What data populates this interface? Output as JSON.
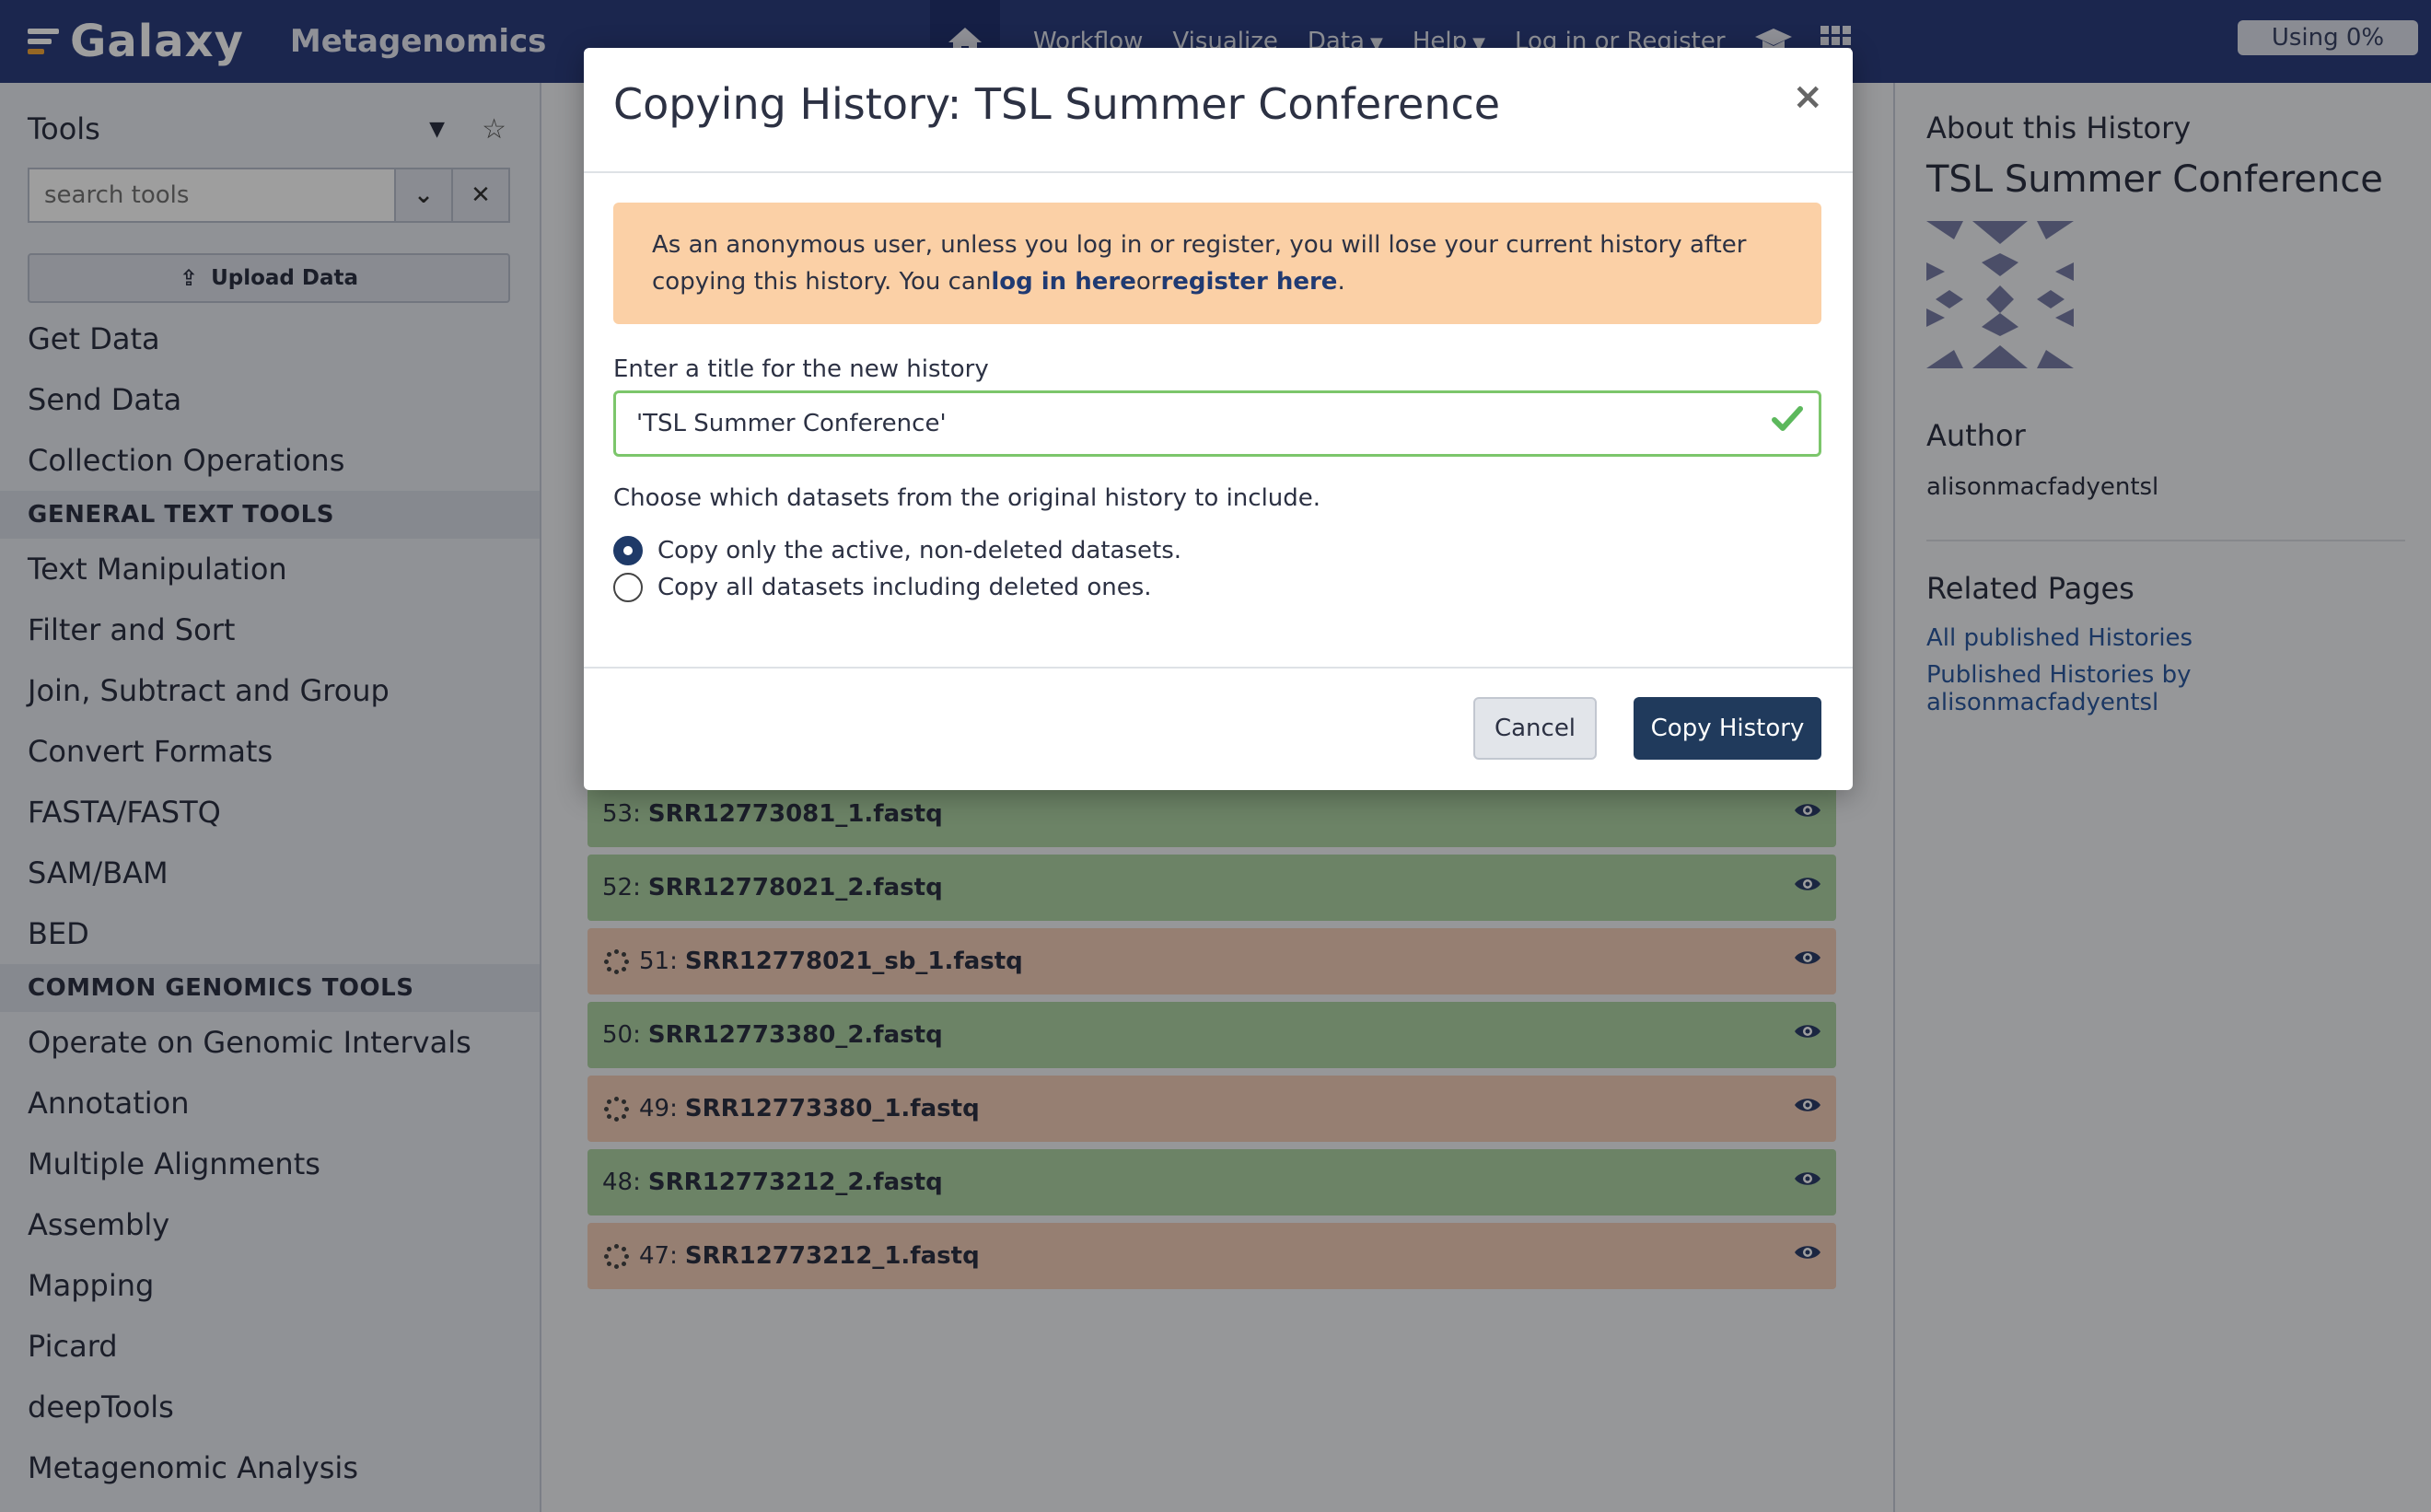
{
  "masthead": {
    "brand": "Galaxy",
    "subtitle": "Metagenomics",
    "nav": {
      "workflow": "Workflow",
      "visualize": "Visualize",
      "data": "Data",
      "help": "Help",
      "login": "Log in or Register"
    },
    "quota": "Using 0%"
  },
  "tools": {
    "title": "Tools",
    "search_placeholder": "search tools",
    "upload_label": "Upload Data",
    "items": [
      {
        "type": "item",
        "label": "Get Data"
      },
      {
        "type": "item",
        "label": "Send Data"
      },
      {
        "type": "item",
        "label": "Collection Operations"
      },
      {
        "type": "section",
        "label": "GENERAL TEXT TOOLS"
      },
      {
        "type": "item",
        "label": "Text Manipulation"
      },
      {
        "type": "item",
        "label": "Filter and Sort"
      },
      {
        "type": "item",
        "label": "Join, Subtract and Group"
      },
      {
        "type": "item",
        "label": "Convert Formats"
      },
      {
        "type": "item",
        "label": "FASTA/FASTQ"
      },
      {
        "type": "item",
        "label": "SAM/BAM"
      },
      {
        "type": "item",
        "label": "BED"
      },
      {
        "type": "section",
        "label": "COMMON GENOMICS TOOLS"
      },
      {
        "type": "item",
        "label": "Operate on Genomic Intervals"
      },
      {
        "type": "item",
        "label": "Annotation"
      },
      {
        "type": "item",
        "label": "Multiple Alignments"
      },
      {
        "type": "item",
        "label": "Assembly"
      },
      {
        "type": "item",
        "label": "Mapping"
      },
      {
        "type": "item",
        "label": "Picard"
      },
      {
        "type": "item",
        "label": "deepTools"
      },
      {
        "type": "item",
        "label": "Metagenomic Analysis"
      }
    ]
  },
  "datasets": [
    {
      "hid": "53:",
      "name": "SRR12773081_1.fastq",
      "state": "ok"
    },
    {
      "hid": "52:",
      "name": "SRR12778021_2.fastq",
      "state": "ok"
    },
    {
      "hid": "51:",
      "name": "SRR12778021_sb_1.fastq",
      "state": "queued"
    },
    {
      "hid": "50:",
      "name": "SRR12773380_2.fastq",
      "state": "ok"
    },
    {
      "hid": "49:",
      "name": "SRR12773380_1.fastq",
      "state": "queued"
    },
    {
      "hid": "48:",
      "name": "SRR12773212_2.fastq",
      "state": "ok"
    },
    {
      "hid": "47:",
      "name": "SRR12773212_1.fastq",
      "state": "queued"
    }
  ],
  "about": {
    "heading": "About this History",
    "title": "TSL Summer Conference",
    "author_heading": "Author",
    "author": "alisonmacfadyentsl",
    "related_heading": "Related Pages",
    "link_all": "All published Histories",
    "link_by_author": "Published Histories by alisonmacfadyentsl"
  },
  "modal": {
    "title": "Copying History: TSL Summer Conference",
    "close": "×",
    "alert_text": "As an anonymous user, unless you log in or register, you will lose your current history after copying this history. You can",
    "alert_login": "log in here",
    "alert_or": "or",
    "alert_register": "register here",
    "alert_end": ".",
    "title_label": "Enter a title for the new history",
    "title_value": "'TSL Summer Conference'",
    "choose_label": "Choose which datasets from the original history to include.",
    "option_active": "Copy only the active, non-deleted datasets.",
    "option_all": "Copy all datasets including deleted ones.",
    "cancel": "Cancel",
    "copy": "Copy History"
  },
  "colors": {
    "masthead": "#2c3e7e",
    "ok_state": "#afd3a5",
    "queued_state": "#f3cdb9",
    "alert": "#fbd0a6",
    "primary_button": "#203a5c"
  }
}
